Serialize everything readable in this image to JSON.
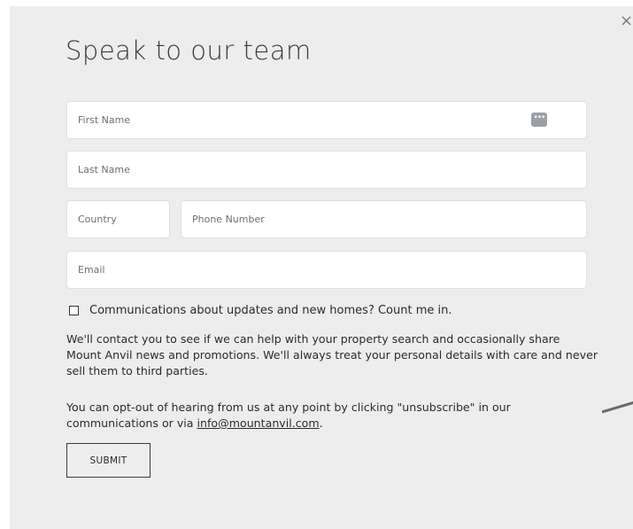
{
  "modal": {
    "close_glyph": "×",
    "title": "Speak to our team"
  },
  "form": {
    "first_name_placeholder": "First Name",
    "last_name_placeholder": "Last Name",
    "country_placeholder": "Country",
    "phone_placeholder": "Phone Number",
    "email_placeholder": "Email",
    "password_manager_icon": "•••",
    "consent_label": "Communications about updates and new homes? Count me in.",
    "consent_checked": false,
    "privacy_text": "We'll contact you to see if we can help with your property search and occasionally share Mount Anvil news and promotions. We'll always treat your personal details with care and never sell them to third parties.",
    "optout_text_before": "You can opt-out of hearing from us at any point by clicking \"unsubscribe\" in our communications or via ",
    "optout_email": "info@mountanvil.com",
    "optout_text_after": ".",
    "submit_label": "SUBMIT"
  },
  "icons": {
    "close": "close-icon",
    "password_manager": "password-manager-icon",
    "checkbox": "checkbox-icon"
  },
  "colors": {
    "modal_background": "#ededed",
    "field_background": "#ffffff",
    "text": "#2b2b2b"
  }
}
